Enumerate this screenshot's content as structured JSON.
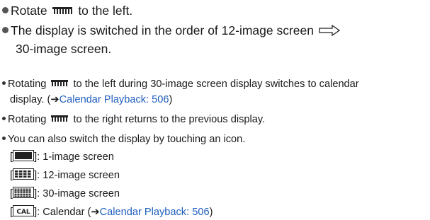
{
  "instructions": {
    "rotate_prefix": "Rotate",
    "rotate_suffix": "to the left.",
    "switch_line1": "The display is switched in the order of 12-image screen",
    "switch_line2": "30-image screen."
  },
  "notes": {
    "note1_prefix": "Rotating",
    "note1_suffix": "to the left during 30-image screen display switches to calendar",
    "note1_line2": "display. (",
    "note1_link": "Calendar Playback: 506",
    "note1_close": ")",
    "note2_prefix": "Rotating",
    "note2_suffix": "to the right returns to the previous display.",
    "note3": "You can also switch the display by touching an icon."
  },
  "icon_items": [
    {
      "label": ": 1-image screen",
      "icon": "single-image-icon"
    },
    {
      "label": ": 12-image screen",
      "icon": "twelve-image-icon"
    },
    {
      "label": ": 30-image screen",
      "icon": "thirty-image-icon"
    },
    {
      "label_prefix": ": Calendar (",
      "link": "Calendar Playback: 506",
      "close": ")",
      "icon": "calendar-icon",
      "icon_text": "CAL"
    }
  ],
  "symbols": {
    "arrow": "➔",
    "open_bracket": "[",
    "close_bracket": "]"
  },
  "colors": {
    "text": "#1a1a1a",
    "link": "#1f5fbf"
  }
}
